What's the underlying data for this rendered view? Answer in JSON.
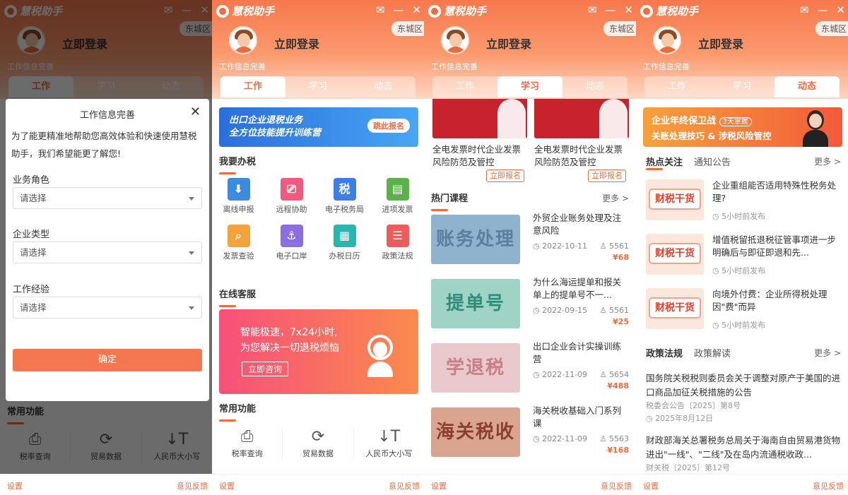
{
  "app": {
    "name": "慧税助手",
    "district": "东城区",
    "login": "立即登录",
    "info_complete": "工作信息完善",
    "tabs": [
      "工作",
      "学习",
      "动态"
    ],
    "settings": "设置",
    "feedback": "意见反馈",
    "win_mail": "✉",
    "win_min": "—",
    "win_close": "✕"
  },
  "colors": {
    "accent": "#f26a3f",
    "header_top": "#f7784c",
    "header_bottom": "#ffd6c2"
  },
  "modal": {
    "title": "工作信息完善",
    "close": "✕",
    "desc": "为了能更精准地帮助您高效体验和快速使用慧税助手，我们希望能更了解您!",
    "fields": [
      {
        "label": "业务角色",
        "placeholder": "请选择"
      },
      {
        "label": "企业类型",
        "placeholder": "请选择"
      },
      {
        "label": "工作经验",
        "placeholder": "请选择"
      }
    ],
    "confirm": "确定"
  },
  "work": {
    "banner": {
      "line1": "出口企业退税业务",
      "line2": "全方位技能提升训练营",
      "button": "跳此报名"
    },
    "tax_section": "我要办税",
    "tax_items": [
      {
        "label": "离线申报",
        "icon": "download-icon",
        "color": "#3b8be0",
        "glyph": "⬇"
      },
      {
        "label": "远程协助",
        "icon": "monitor-icon",
        "color": "#ef5a7e",
        "glyph": "⎚"
      },
      {
        "label": "电子税务局",
        "icon": "tax-bureau-icon",
        "color": "#3d7fe3",
        "glyph": "税"
      },
      {
        "label": "进项发票",
        "icon": "invoice-icon",
        "color": "#5cb24a",
        "glyph": "▤"
      },
      {
        "label": "发票查验",
        "icon": "invoice-check-icon",
        "color": "#f4a23a",
        "glyph": "⌕"
      },
      {
        "label": "电子口岸",
        "icon": "anchor-icon",
        "color": "#8d6ee0",
        "glyph": "⚓"
      },
      {
        "label": "办税日历",
        "icon": "calendar-icon",
        "color": "#2bb5b0",
        "glyph": "▦"
      },
      {
        "label": "政策法规",
        "icon": "policy-icon",
        "color": "#ef5a5a",
        "glyph": "☰"
      }
    ],
    "service_section": "在线客服",
    "service_banner": {
      "line1": "智能极速，7x24小时,",
      "line2": "为您解决一切退税烦恼",
      "button": "立即咨询"
    },
    "common_section": "常用功能",
    "common": [
      {
        "label": "税率查询",
        "icon": "rate-query-icon",
        "glyph": "⎙"
      },
      {
        "label": "贸易数据",
        "icon": "trade-data-icon",
        "glyph": "⟳"
      },
      {
        "label": "人民币大小写",
        "icon": "currency-case-icon",
        "glyph": "↓T"
      }
    ]
  },
  "study": {
    "top_cards": [
      {
        "title": "全电发票时代企业发票风险防范及管控",
        "button": "立即报名"
      },
      {
        "title": "全电发票时代企业发票风险防范及管控",
        "button": "立即报名"
      }
    ],
    "hot_section": "热门课程",
    "more": "更多 >",
    "courses": [
      {
        "title": "外贸企业账务处理及注意风险",
        "date": "2022-10-11",
        "views": "5561",
        "price": "¥68",
        "thumb": "账务处理",
        "bg": "#8fb3cf",
        "fg": "#5b7f9e"
      },
      {
        "title": "为什么海运提单和报关单上的提单号不一...",
        "date": "2022-09-15",
        "views": "5561",
        "price": "¥25",
        "thumb": "提单号",
        "bg": "#9fd3c6",
        "fg": "#2f8e78"
      },
      {
        "title": "出口企业会计实操训练营",
        "date": "2022-11-09",
        "views": "5654",
        "price": "¥488",
        "thumb": "学退税",
        "bg": "#e9c9cc",
        "fg": "#c77f88"
      },
      {
        "title": "海关税收基础入门系列课",
        "date": "2022-11-09",
        "views": "5563",
        "price": "¥168",
        "thumb": "海关税收",
        "bg": "#d9a58e",
        "fg": "#8c3f2b"
      }
    ]
  },
  "news": {
    "banner": {
      "line1": "企业年终保卫战",
      "tag": "3天掌握",
      "line2": "关账处理技巧 & 涉税风险管控"
    },
    "hot_tab": "热点关注",
    "notice_tab": "通知公告",
    "more": "更多 >",
    "items": [
      {
        "title": "企业重组能否适用特殊性税务处理?",
        "time": "5小时前发布",
        "thumb": "财税干货"
      },
      {
        "title": "增值税留抵退税征管事项进一步明确后与即征即退和先...",
        "time": "5小时前发布",
        "thumb": "财税干货"
      },
      {
        "title": "向境外付费：企业所得税处理因\"费\"而异",
        "time": "5小时前发布",
        "thumb": "财税干货"
      }
    ],
    "policy_tab": "政策法规",
    "interp_tab": "政策解读",
    "policies": [
      {
        "title": "国务院关税税则委员会关于调整对原产于美国的进口商品加征关税措施的公告",
        "sub": "税委会公告〔2025〕第8号",
        "date": "2025年8月12日"
      },
      {
        "title": "财政部海关总署税务总局关于海南自由贸易港货物进出\"一线\"、\"二线\"及在岛内流通税收政...",
        "sub": "财关税〔2025〕第12号",
        "date": ""
      }
    ]
  }
}
